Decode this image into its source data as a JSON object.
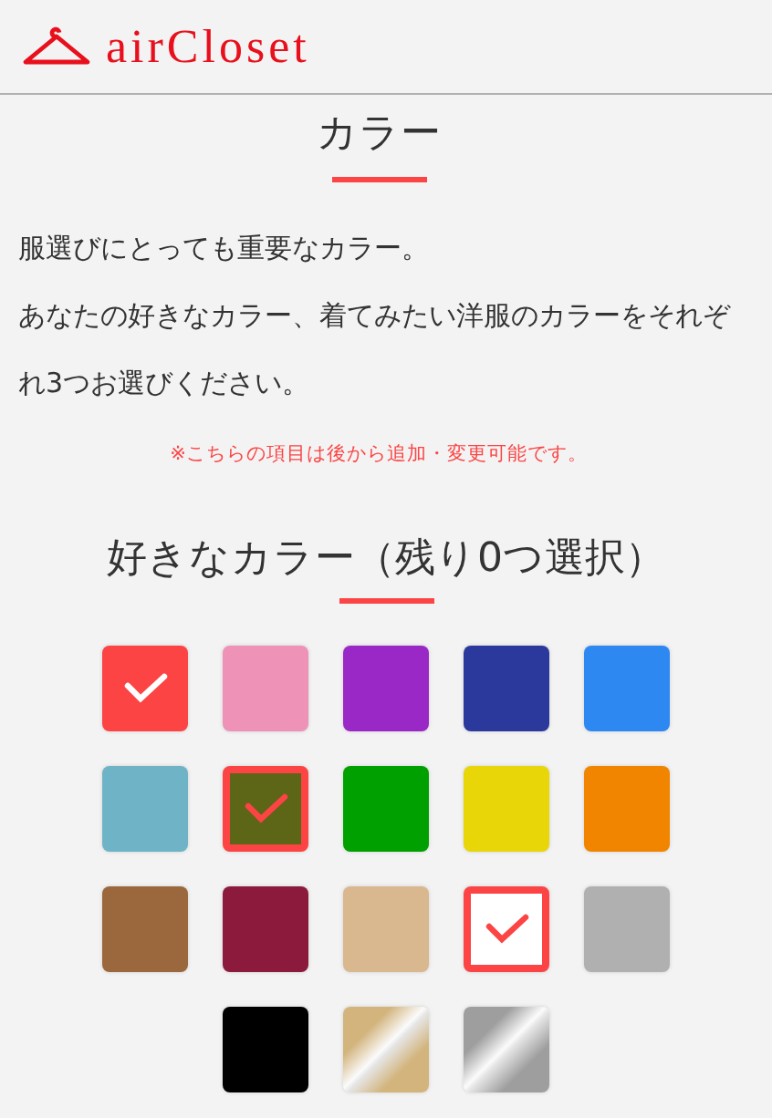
{
  "header": {
    "logo": "airCloset"
  },
  "section": {
    "title": "カラー",
    "paragraphs": [
      "服選びにとっても重要なカラー。",
      "あなたの好きなカラー、着てみたい洋服のカラーをそれぞれ3つお選びください。"
    ],
    "note": "※こちらの項目は後から追加・変更可能です。"
  },
  "picker": {
    "title": "好きなカラー（残り0つ選択）",
    "swatches": [
      {
        "kind": "solid",
        "color": "#fc4444",
        "selected": true
      },
      {
        "kind": "solid",
        "color": "#ee92b8",
        "selected": false
      },
      {
        "kind": "solid",
        "color": "#9a28c6",
        "selected": false
      },
      {
        "kind": "solid",
        "color": "#2b389c",
        "selected": false
      },
      {
        "kind": "solid",
        "color": "#2e88f2",
        "selected": false
      },
      {
        "kind": "solid",
        "color": "#6eb3c6",
        "selected": false
      },
      {
        "kind": "solid",
        "color": "#5d6517",
        "selected": true
      },
      {
        "kind": "solid",
        "color": "#00a000",
        "selected": false
      },
      {
        "kind": "solid",
        "color": "#e8d608",
        "selected": false
      },
      {
        "kind": "solid",
        "color": "#f18500",
        "selected": false
      },
      {
        "kind": "solid",
        "color": "#9b673c",
        "selected": false
      },
      {
        "kind": "solid",
        "color": "#8b1a3c",
        "selected": false
      },
      {
        "kind": "solid",
        "color": "#d9b78f",
        "selected": false
      },
      {
        "kind": "solid",
        "color": "#ffffff",
        "selected": true
      },
      {
        "kind": "solid",
        "color": "#b0b0b0",
        "selected": false
      },
      {
        "kind": "solid",
        "color": "#000000",
        "selected": false
      },
      {
        "kind": "metallic",
        "color": "#d2b47c",
        "selected": false
      },
      {
        "kind": "metallic",
        "color": "#9e9e9e",
        "selected": false
      }
    ]
  }
}
